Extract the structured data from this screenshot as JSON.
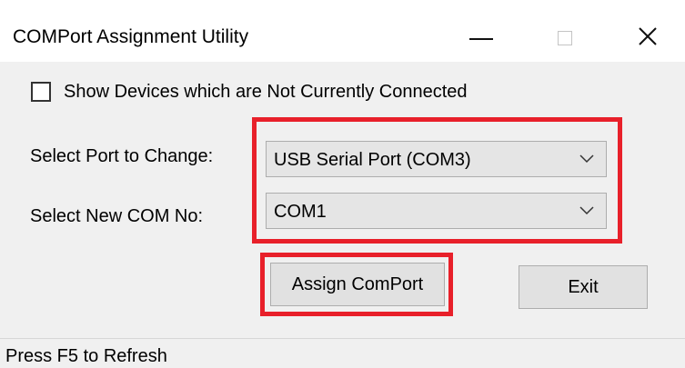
{
  "window": {
    "title": "COMPort Assignment Utility",
    "controls": {
      "minimize_icon": "minimize-icon",
      "maximize_icon": "maximize-icon",
      "close_icon": "close-icon"
    }
  },
  "options": {
    "show_disconnected_label": "Show Devices which are Not Currently Connected",
    "show_disconnected_checked": false
  },
  "form": {
    "port_label": "Select Port to Change:",
    "port_value": "USB Serial Port (COM3)",
    "com_label": "Select New COM No:",
    "com_value": "COM1"
  },
  "buttons": {
    "assign_label": "Assign ComPort",
    "exit_label": "Exit"
  },
  "status": {
    "text": "Press F5 to Refresh"
  },
  "colors": {
    "highlight": "#e8202a",
    "window_background": "#f0f0f0",
    "titlebar_background": "#ffffff",
    "combo_background": "#e5e5e5",
    "button_background": "#e1e1e1"
  }
}
